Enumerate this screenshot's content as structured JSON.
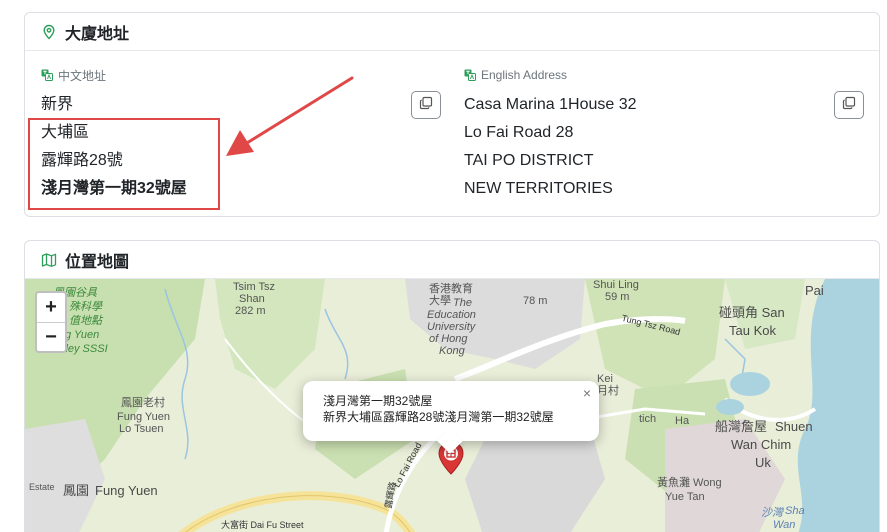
{
  "address_card": {
    "title": "大廈地址",
    "chinese": {
      "label": "中文地址",
      "lines": [
        "新界",
        "大埔區",
        "露輝路28號",
        "淺月灣第一期32號屋"
      ]
    },
    "english": {
      "label": "English Address",
      "lines": [
        "Casa Marina 1House 32",
        "Lo Fai Road 28",
        "TAI PO DISTRICT",
        "NEW TERRITORIES"
      ]
    }
  },
  "map_card": {
    "title": "位置地圖",
    "zoom_in": "+",
    "zoom_out": "−",
    "popup": {
      "title": "淺月灣第一期32號屋",
      "subtitle": "新界大埔區露輝路28號淺月灣第一期32號屋",
      "close": "×"
    },
    "labels": {
      "fung_yuen_top": "鳳園谷具",
      "special": "殊科學",
      "value_site": "值地點",
      "fung_yuen_valley": "g Yuen",
      "valley_sssi": "lley SSSI",
      "tsim_tsz": "Tsim Tsz",
      "shan": "Shan",
      "height_282": "282 m",
      "eduhk_zh": "香港教育",
      "eduhk_zh2": "大學",
      "eduhk_en1": "The",
      "eduhk_en2": "Education",
      "eduhk_en3": "University",
      "eduhk_en4": "of Hong",
      "eduhk_en5": "Kong",
      "height_78": "78 m",
      "shui_ling": "Shui Ling",
      "height_59": "59 m",
      "tung_tsz_road": "Tung Tsz Road",
      "pai": "Pai",
      "tai_kok_zh": "碰頭角 San",
      "tai_kok_en": "Tau Kok",
      "lo_tsuen_zh": "鳳園老村",
      "lo_tsuen_en1": "Fung Yuen",
      "lo_tsuen_en2": "Lo Tsuen",
      "kei": "Kei",
      "kei_zh": "月村",
      "tich": "tich",
      "tich_ha": "Ha",
      "shuen_wan_zh": "船灣詹屋",
      "shuen_wan_en1": "Shuen",
      "shuen_wan_en2": "Wan Chim",
      "shuen_wan_en3": "Uk",
      "fung_yuen_bottom_zh": "鳳園",
      "fung_yuen_bottom_en": "Fung Yuen",
      "estate": "Estate",
      "wong_yue_zh": "黃魚灘 Wong",
      "wong_yue_en": "Yue Tan",
      "lo_fai_road": "Lo Fai Road",
      "lo_fai_zh": "露輝路",
      "dai_fu_street": "大富街 Dai Fu Street",
      "sha_wan_zh": "沙灣",
      "sha_wan_en": "Sha",
      "sha_wan_en2": "Wan"
    }
  }
}
